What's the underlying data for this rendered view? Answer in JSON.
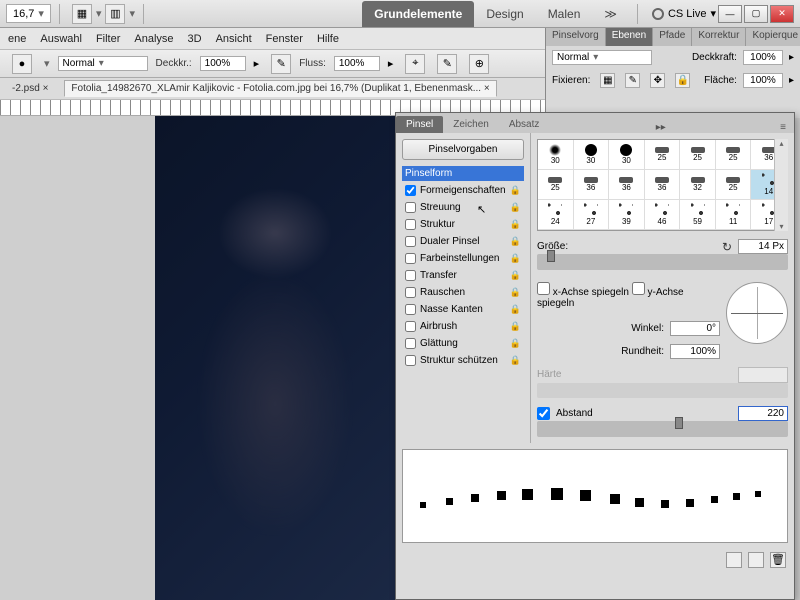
{
  "topbar": {
    "zoom": "16,7",
    "tabs": {
      "grundelemente": "Grundelemente",
      "design": "Design",
      "malen": "Malen",
      "more": "≫"
    },
    "cslive": "CS Live"
  },
  "menubar": {
    "items": [
      "ene",
      "Auswahl",
      "Filter",
      "Analyse",
      "3D",
      "Ansicht",
      "Fenster",
      "Hilfe"
    ]
  },
  "optbar": {
    "mode_label": "Normal",
    "deckkr_label": "Deckkr.:",
    "deckkr_val": "100%",
    "fluss_label": "Fluss:",
    "fluss_val": "100%"
  },
  "doctabs": {
    "t1": "-2.psd",
    "t2": "Fotolia_14982670_XLAmir Kaljikovic - Fotolia.com.jpg bei 16,7% (Duplikat 1, Ebenenmask..."
  },
  "rightdock": {
    "tabs": [
      "Pinselvorg",
      "Ebenen",
      "Pfade",
      "Korrektur",
      "Kopierque"
    ],
    "mode": "Normal",
    "deckkraft_label": "Deckkraft:",
    "deckkraft_val": "100%",
    "fixieren_label": "Fixieren:",
    "flaeche_label": "Fläche:",
    "flaeche_val": "100%"
  },
  "brushpanel": {
    "tabs": {
      "pinsel": "Pinsel",
      "zeichen": "Zeichen",
      "absatz": "Absatz"
    },
    "preset_btn": "Pinselvorgaben",
    "items": {
      "pinselform": "Pinselform",
      "formeigenschaften": "Formeigenschaften",
      "streuung": "Streuung",
      "struktur": "Struktur",
      "dualer": "Dualer Pinsel",
      "farbe": "Farbeinstellungen",
      "transfer": "Transfer",
      "rauschen": "Rauschen",
      "nasse": "Nasse Kanten",
      "airbrush": "Airbrush",
      "glaettung": "Glättung",
      "strukturschutz": "Struktur schützen"
    },
    "brush_sizes_row1": [
      "30",
      "30",
      "30",
      "25",
      "25",
      "25",
      "36"
    ],
    "brush_sizes_row2": [
      "25",
      "36",
      "36",
      "36",
      "32",
      "25",
      "14"
    ],
    "brush_sizes_row3": [
      "24",
      "27",
      "39",
      "46",
      "59",
      "11",
      "17"
    ],
    "groesse_label": "Größe:",
    "groesse_val": "14 Px",
    "flipx": "x-Achse spiegeln",
    "flipy": "y-Achse spiegeln",
    "winkel_label": "Winkel:",
    "winkel_val": "0°",
    "rundheit_label": "Rundheit:",
    "rundheit_val": "100%",
    "haerte_label": "Härte",
    "abstand_label": "Abstand",
    "abstand_val": "220"
  }
}
